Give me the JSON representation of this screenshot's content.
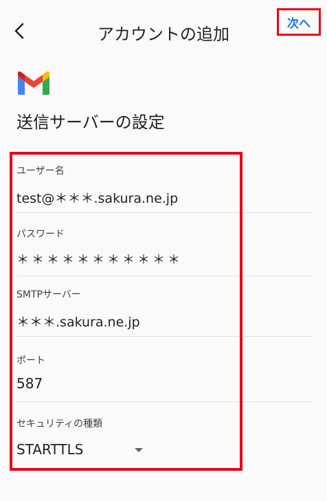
{
  "header": {
    "title": "アカウントの追加",
    "next_label": "次へ",
    "back_icon": "chevron-left-icon"
  },
  "logo": {
    "icon": "gmail-logo-icon",
    "colors": {
      "red": "#ea4335",
      "blue": "#4285f4",
      "green": "#34a853",
      "yellow": "#fbbc04",
      "dark_red": "#c5221f"
    }
  },
  "section": {
    "title": "送信サーバーの設定"
  },
  "form": {
    "username": {
      "label": "ユーザー名",
      "value": "test@＊＊＊.sakura.ne.jp"
    },
    "password": {
      "label": "パスワード",
      "value": "＊＊＊＊＊＊＊＊＊＊＊"
    },
    "smtp_server": {
      "label": "SMTPサーバー",
      "value": "＊＊＊.sakura.ne.jp"
    },
    "port": {
      "label": "ポート",
      "value": "587"
    },
    "security": {
      "label": "セキュリティの種類",
      "value": "STARTTLS"
    }
  },
  "colors": {
    "highlight_red": "#e60012",
    "link_blue": "#1a73e8"
  }
}
